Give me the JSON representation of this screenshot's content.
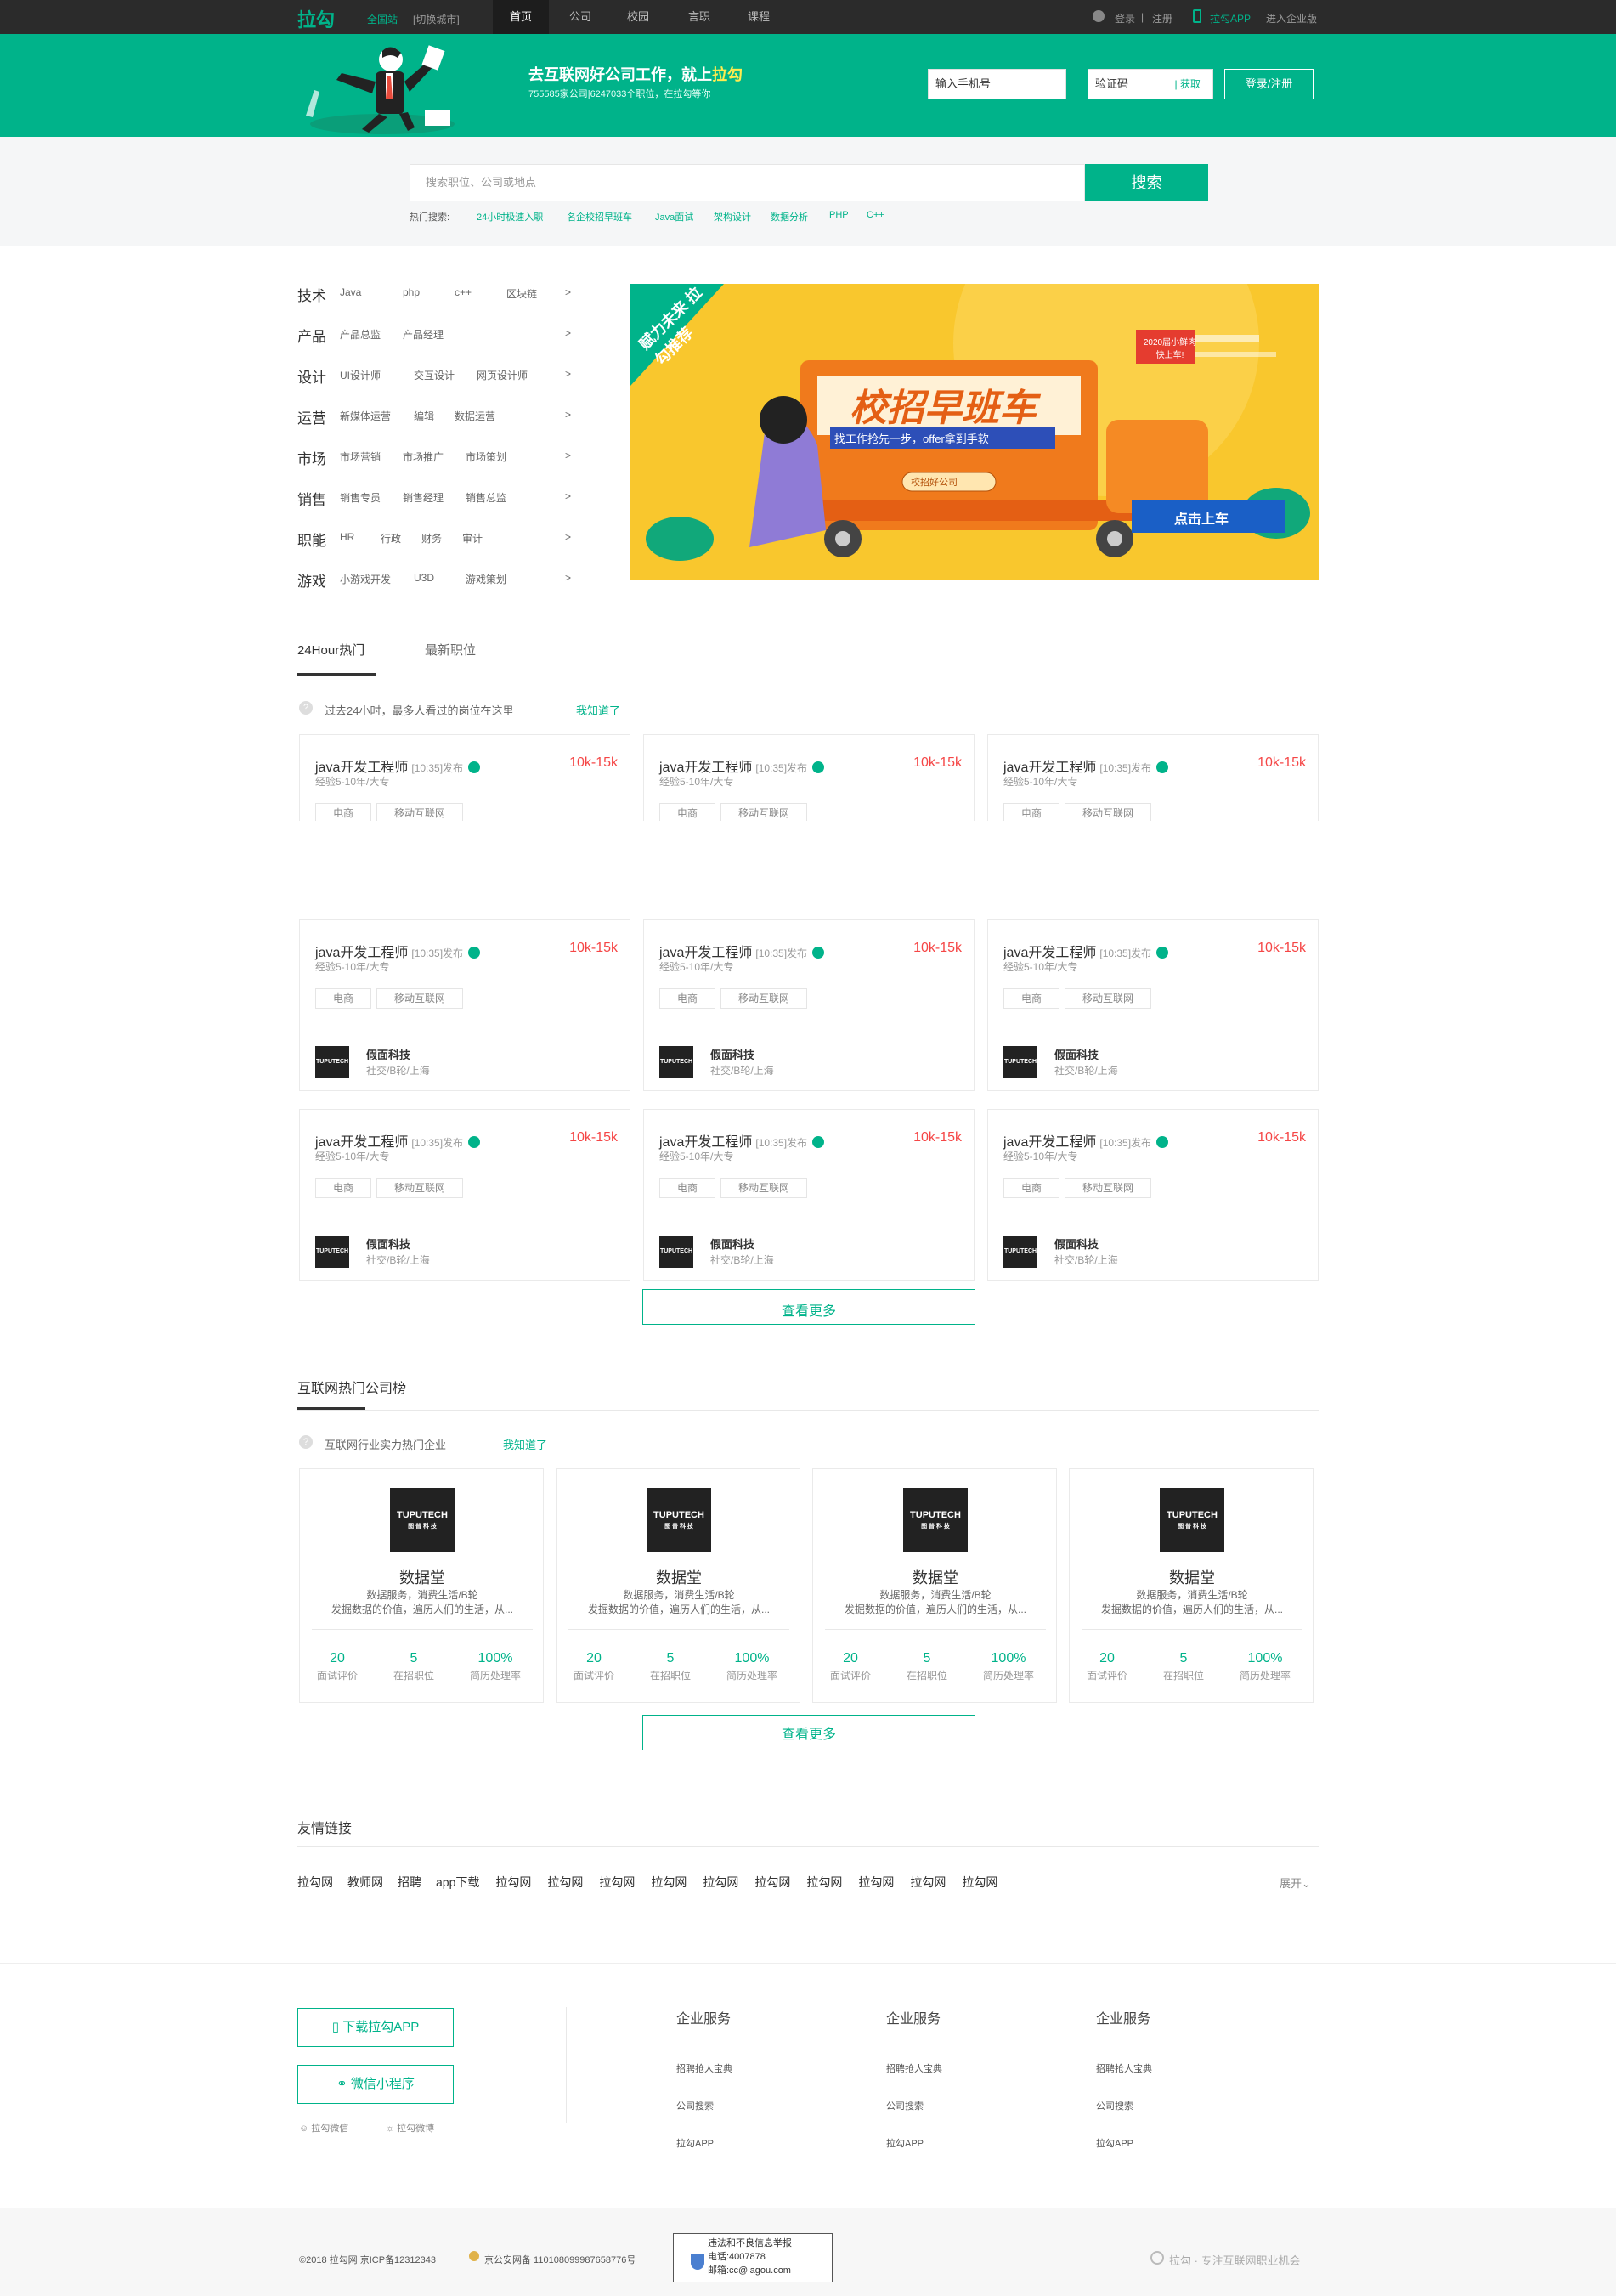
{
  "topbar": {
    "logo": "拉勾",
    "site": "全国站",
    "switch_city": "[切换城市]",
    "nav": [
      "首页",
      "公司",
      "校园",
      "言职",
      "课程"
    ],
    "login": "登录",
    "sep": "|",
    "register": "注册",
    "app": "拉勾APP",
    "enterprise": "进入企业版"
  },
  "banner": {
    "title_prefix": "去互联网好公司工作，就上",
    "title_brand": "拉勾",
    "subtitle": "755585家公司|6247033个职位，在拉勾等你",
    "phone_placeholder": "输入手机号",
    "code_placeholder": "验证码",
    "get_code": "获取",
    "login_btn": "登录/注册"
  },
  "search": {
    "placeholder": "搜索职位、公司或地点",
    "button": "搜索",
    "hot_label": "热门搜索:",
    "hot": [
      "24小时极速入职",
      "名企校招早班车",
      "Java面试",
      "架构设计",
      "数据分析",
      "PHP",
      "C++"
    ]
  },
  "categories": [
    {
      "name": "技术",
      "items": [
        "Java",
        "php",
        "c++",
        "区块链"
      ]
    },
    {
      "name": "产品",
      "items": [
        "产品总监",
        "产品经理"
      ]
    },
    {
      "name": "设计",
      "items": [
        "UI设计师",
        "交互设计",
        "网页设计师"
      ]
    },
    {
      "name": "运营",
      "items": [
        "新媒体运营",
        "编辑",
        "数据运营"
      ]
    },
    {
      "name": "市场",
      "items": [
        "市场营销",
        "市场推广",
        "市场策划"
      ]
    },
    {
      "name": "销售",
      "items": [
        "销售专员",
        "销售经理",
        "销售总监"
      ]
    },
    {
      "name": "职能",
      "items": [
        "HR",
        "行政",
        "财务",
        "审计"
      ]
    },
    {
      "name": "游戏",
      "items": [
        "小游戏开发",
        "U3D",
        "游戏策划"
      ]
    }
  ],
  "category_arrow": ">",
  "promo": {
    "corner": "赋力未来 拉勾推荐",
    "title": "校招早班车",
    "slogan": "找工作抢先一步，offer拿到手软",
    "badge": "2020届小鲜肉 快上车!",
    "sign": "校招好公司",
    "cta": "点击上车"
  },
  "jobs_section": {
    "tabs": [
      "24Hour热门",
      "最新职位"
    ],
    "notice": "过去24小时，最多人看过的岗位在这里",
    "notice_link": "我知道了",
    "more": "查看更多"
  },
  "jobs": [
    {
      "title": "java开发工程师",
      "time": "[10:35]发布",
      "salary": "10k-15k",
      "exp": "经验5-10年/大专",
      "tags": [
        "电商",
        "移动互联网"
      ],
      "company": "假面科技",
      "company_info": "社交/B轮/上海"
    }
  ],
  "logo_text": "TUPUTECH",
  "logo_sub": "图 普 科 技",
  "companies_section": {
    "title": "互联网热门公司榜",
    "notice": "互联网行业实力热门企业",
    "notice_link": "我知道了",
    "more": "查看更多"
  },
  "company_card": {
    "name": "数据堂",
    "desc1": "数据服务，消费生活/B轮",
    "desc2": "发掘数据的价值，遍历人们的生活，从...",
    "stats": [
      {
        "v": "20",
        "l": "面试评价"
      },
      {
        "v": "5",
        "l": "在招职位"
      },
      {
        "v": "100%",
        "l": "简历处理率"
      }
    ]
  },
  "links": {
    "title": "友情链接",
    "items": [
      "拉勾网",
      "教师网",
      "招聘",
      "app下载",
      "拉勾网",
      "拉勾网",
      "拉勾网",
      "拉勾网",
      "拉勾网",
      "拉勾网",
      "拉勾网",
      "拉勾网",
      "拉勾网",
      "拉勾网"
    ],
    "expand": "展开"
  },
  "footer": {
    "download": "下载拉勾APP",
    "mini": "微信小程序",
    "wechat": "拉勾微信",
    "weibo": "拉勾微博",
    "col_title": "企业服务",
    "col_items": [
      "招聘抢人宝典",
      "公司搜索",
      "拉勾APP"
    ]
  },
  "bottom": {
    "copyright": "©2018 拉勾网 京ICP备12312343",
    "police": "京公安网备 11010809998765877​6号",
    "report1": "违法和不良信息举报",
    "report2": "电话:4007878",
    "report3": "邮箱:cc@lagou.com",
    "slogan": "拉勾 · 专注互联网职业机会"
  }
}
